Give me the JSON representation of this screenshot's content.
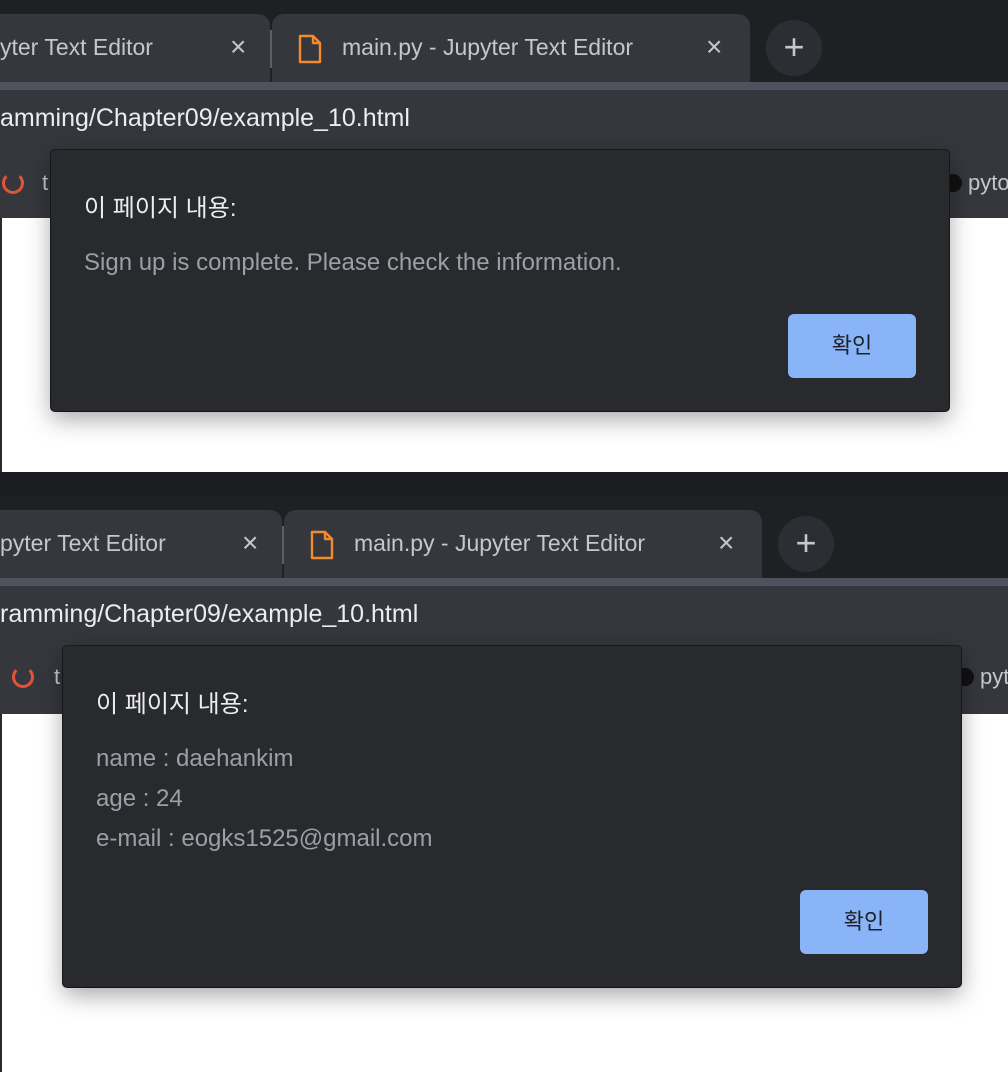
{
  "colors": {
    "chrome_bg": "#1e2024",
    "tab_bg": "#35373d",
    "dialog_bg": "#292a2d",
    "accent": "#8ab4f8",
    "file_icon": "#f28b30"
  },
  "screenshot1": {
    "tabs": [
      {
        "title": "yter Text Editor",
        "close": "×"
      },
      {
        "title": "main.py - Jupyter Text Editor",
        "close": "×"
      }
    ],
    "new_tab": "+",
    "url": "amming/Chapter09/example_10.html",
    "bookmarks": {
      "left": "t",
      "right": "pyto"
    },
    "dialog": {
      "title": "이 페이지 내용:",
      "messages": [
        "Sign up is complete. Please check the information."
      ],
      "ok_label": "확인"
    }
  },
  "screenshot2": {
    "tabs": [
      {
        "title": "pyter Text Editor",
        "close": "×"
      },
      {
        "title": "main.py - Jupyter Text Editor",
        "close": "×"
      }
    ],
    "new_tab": "+",
    "url": "ramming/Chapter09/example_10.html",
    "bookmarks": {
      "left": "t",
      "right": "pyt"
    },
    "dialog": {
      "title": "이 페이지 내용:",
      "messages": [
        "name : daehankim",
        "age : 24",
        "e-mail : eogks1525@gmail.com"
      ],
      "ok_label": "확인"
    }
  }
}
